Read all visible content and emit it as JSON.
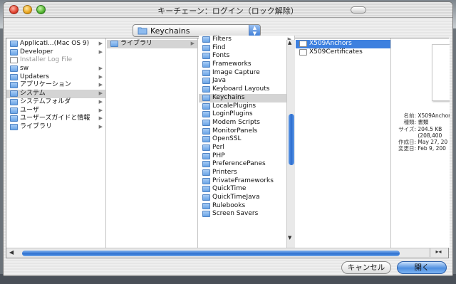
{
  "window": {
    "title": "キーチェーン：ログイン（ロック解除）"
  },
  "location": {
    "label": "Keychains"
  },
  "columns": {
    "col1": [
      {
        "label": "Applicati...(Mac OS 9)",
        "icon": "folder-icon",
        "arrow": true,
        "state": ""
      },
      {
        "label": "Developer",
        "icon": "folder-icon",
        "arrow": true,
        "state": ""
      },
      {
        "label": "Installer Log File",
        "icon": "document-icon",
        "arrow": false,
        "state": "dim"
      },
      {
        "label": "sw",
        "icon": "folder-icon",
        "arrow": true,
        "state": ""
      },
      {
        "label": "Updaters",
        "icon": "folder-icon",
        "arrow": true,
        "state": ""
      },
      {
        "label": "アプリケーション",
        "icon": "applications-folder-icon",
        "arrow": true,
        "state": ""
      },
      {
        "label": "システム",
        "icon": "system-folder-icon",
        "arrow": true,
        "state": "sel"
      },
      {
        "label": "システムフォルダ",
        "icon": "folder-icon",
        "arrow": true,
        "state": ""
      },
      {
        "label": "ユーザ",
        "icon": "users-folder-icon",
        "arrow": true,
        "state": ""
      },
      {
        "label": "ユーザーズガイドと情報",
        "icon": "folder-icon",
        "arrow": true,
        "state": ""
      },
      {
        "label": "ライブラリ",
        "icon": "library-folder-icon",
        "arrow": true,
        "state": ""
      }
    ],
    "col2": [
      {
        "label": "ライブラリ",
        "icon": "folder-icon",
        "arrow": true,
        "state": "sel"
      }
    ],
    "col3": [
      {
        "label": "Filters",
        "icon": "folder-icon",
        "arrow": true,
        "state": ""
      },
      {
        "label": "Find",
        "icon": "folder-icon",
        "arrow": true,
        "state": ""
      },
      {
        "label": "Fonts",
        "icon": "folder-icon",
        "arrow": true,
        "state": ""
      },
      {
        "label": "Frameworks",
        "icon": "folder-icon",
        "arrow": true,
        "state": ""
      },
      {
        "label": "Image Capture",
        "icon": "folder-icon",
        "arrow": true,
        "state": ""
      },
      {
        "label": "Java",
        "icon": "folder-icon",
        "arrow": true,
        "state": ""
      },
      {
        "label": "Keyboard Layouts",
        "icon": "folder-icon",
        "arrow": true,
        "state": ""
      },
      {
        "label": "Keychains",
        "icon": "folder-icon",
        "arrow": true,
        "state": "sel"
      },
      {
        "label": "LocalePlugins",
        "icon": "folder-icon",
        "arrow": true,
        "state": ""
      },
      {
        "label": "LoginPlugins",
        "icon": "folder-icon",
        "arrow": true,
        "state": ""
      },
      {
        "label": "Modem Scripts",
        "icon": "folder-icon",
        "arrow": true,
        "state": ""
      },
      {
        "label": "MonitorPanels",
        "icon": "folder-icon",
        "arrow": true,
        "state": ""
      },
      {
        "label": "OpenSSL",
        "icon": "folder-icon",
        "arrow": true,
        "state": ""
      },
      {
        "label": "Perl",
        "icon": "folder-icon",
        "arrow": true,
        "state": ""
      },
      {
        "label": "PHP",
        "icon": "folder-icon",
        "arrow": true,
        "state": ""
      },
      {
        "label": "PreferencePanes",
        "icon": "folder-icon",
        "arrow": true,
        "state": ""
      },
      {
        "label": "Printers",
        "icon": "folder-icon",
        "arrow": true,
        "state": ""
      },
      {
        "label": "PrivateFrameworks",
        "icon": "folder-icon",
        "arrow": true,
        "state": ""
      },
      {
        "label": "QuickTime",
        "icon": "folder-icon",
        "arrow": true,
        "state": ""
      },
      {
        "label": "QuickTimeJava",
        "icon": "folder-icon",
        "arrow": true,
        "state": ""
      },
      {
        "label": "Rulebooks",
        "icon": "folder-icon",
        "arrow": true,
        "state": ""
      },
      {
        "label": "Screen Savers",
        "icon": "folder-icon",
        "arrow": true,
        "state": ""
      }
    ],
    "col4": [
      {
        "label": "X509Anchors",
        "icon": "document-icon",
        "arrow": false,
        "state": "sel-blue"
      },
      {
        "label": "X509Certificates",
        "icon": "document-icon",
        "arrow": false,
        "state": ""
      }
    ]
  },
  "preview": {
    "info": [
      {
        "key": "名前:",
        "value": "X509Anchors"
      },
      {
        "key": "種類:",
        "value": "書類"
      },
      {
        "key": "サイズ:",
        "value": "204.5 KB"
      },
      {
        "key": "",
        "value": "(208,400"
      },
      {
        "key": "作成日:",
        "value": "May 27, 20"
      },
      {
        "key": "変更日:",
        "value": "Feb 9, 200"
      }
    ]
  },
  "buttons": {
    "cancel": "キャンセル",
    "open": "開く"
  },
  "colors": {
    "selection_blue": "#3d80df",
    "accent": "#2c6fd0"
  }
}
